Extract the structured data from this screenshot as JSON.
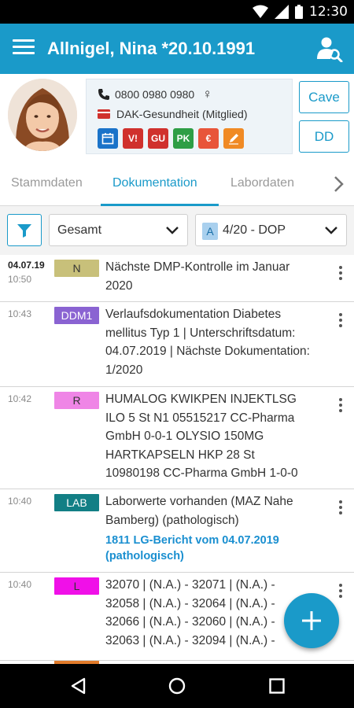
{
  "status_bar": {
    "time": "12:30"
  },
  "app_bar": {
    "title": "Allnigel, Nina *20.10.1991"
  },
  "patient": {
    "phone": "0800 0980 0980",
    "gender_symbol": "♀",
    "insurance": "DAK-Gesundheit (Mitglied)",
    "badges": [
      {
        "label": "",
        "color": "#1a73c9",
        "icon": "calendar-icon"
      },
      {
        "label": "V!",
        "color": "#d0312d"
      },
      {
        "label": "GU",
        "color": "#d0312d"
      },
      {
        "label": "PK",
        "color": "#2e9e45"
      },
      {
        "label": "€",
        "color": "#e8553a"
      },
      {
        "label": "",
        "color": "#f08a24",
        "icon": "pen-icon"
      }
    ],
    "cave_label": "Cave",
    "dd_label": "DD"
  },
  "tabs": {
    "items": [
      "Stammdaten",
      "Dokumentation",
      "Labordaten"
    ],
    "active": "Dokumentation"
  },
  "filters": {
    "type_value": "Gesamt",
    "quarter_badge": "A",
    "quarter_value": "4/20 - DOP"
  },
  "entries": [
    {
      "date": "04.07.19",
      "time": "10:50",
      "badge": "N",
      "badge_bg": "#c8c07a",
      "badge_fg": "#333333",
      "text": "Nächste DMP-Kontrolle im Januar 2020",
      "link": ""
    },
    {
      "date": "",
      "time": "10:43",
      "badge": "DDM1",
      "badge_bg": "#8a63d2",
      "badge_fg": "#ffffff",
      "text": "Verlaufsdokumentation Diabetes mellitus Typ 1 | Unterschriftsdatum: 04.07.2019 | Nächste Dokumentation: 1/2020",
      "link": ""
    },
    {
      "date": "",
      "time": "10:42",
      "badge": "R",
      "badge_bg": "#ef85e6",
      "badge_fg": "#333333",
      "text": "HUMALOG KWIKPEN INJEKTLSG ILO 5 St N1 05515217 CC-Pharma GmbH 0-0-1 OLYSIO 150MG HARTKAPSELN HKP 28 St 10980198 CC-Pharma GmbH 1-0-0",
      "link": ""
    },
    {
      "date": "",
      "time": "10:40",
      "badge": "LAB",
      "badge_bg": "#127f85",
      "badge_fg": "#ffffff",
      "text": "Laborwerte vorhanden (MAZ Nahe Bamberg) (pathologisch)",
      "link": "1811 LG-Bericht vom 04.07.2019 (pathologisch)"
    },
    {
      "date": "",
      "time": "10:40",
      "badge": "L",
      "badge_bg": "#f010e8",
      "badge_fg": "#333333",
      "text": "32070 | (N.A.) - 32071 | (N.A.) - 32058 | (N.A.) - 32064 | (N.A.) - 32066 | (N.A.) - 32060 | (N.A.) - 32063 | (N.A.) - 32094 | (N.A.) -",
      "link": ""
    }
  ]
}
